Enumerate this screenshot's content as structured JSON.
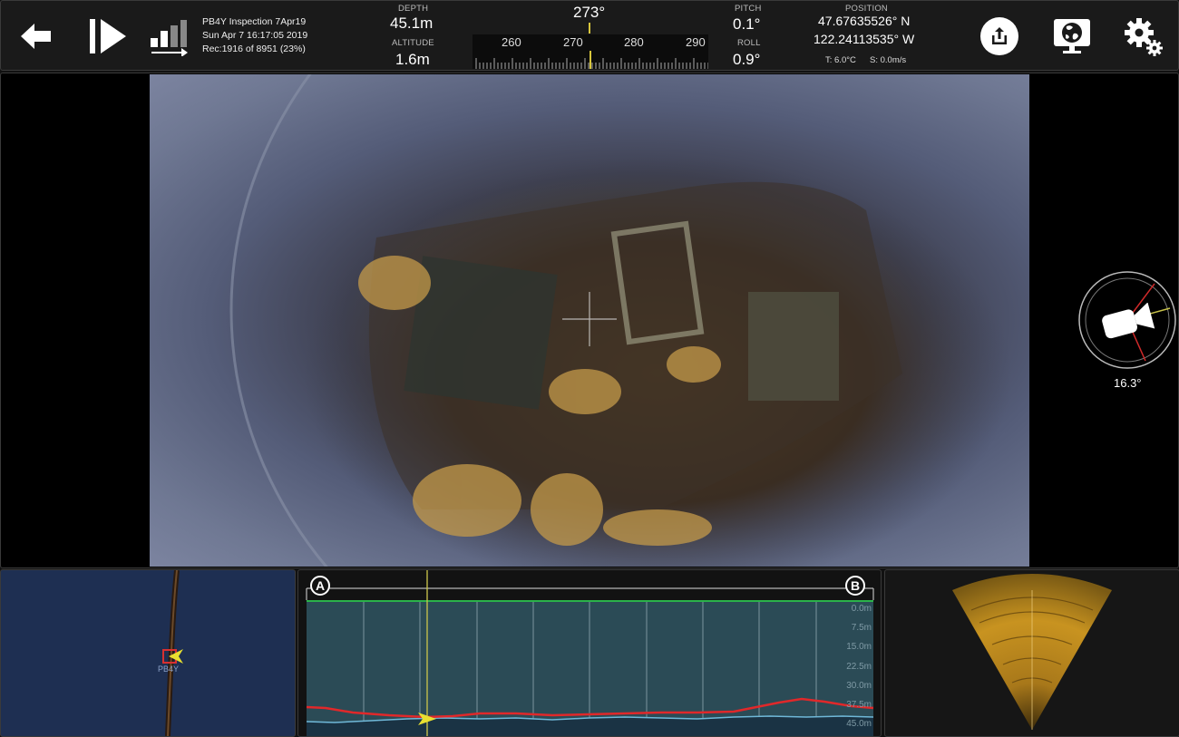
{
  "toolbar": {
    "icons": [
      "back-arrow-icon",
      "play-step-icon",
      "signal-bars-icon",
      "share-icon",
      "screen-globe-icon",
      "settings-gear-icon"
    ],
    "recording": {
      "title": "PB4Y Inspection 7Apr19",
      "datetime": "Sun Apr 7 16:17:05 2019",
      "progress": "Rec:1916 of 8951 (23%)",
      "progress_fraction": 0.23
    }
  },
  "telemetry": {
    "depth_label": "DEPTH",
    "depth_value": "45.1m",
    "altitude_label": "ALTITUDE",
    "altitude_value": "1.6m",
    "heading_value": "273°",
    "heading_ticks": [
      "260",
      "270",
      "280",
      "290"
    ],
    "pitch_label": "PITCH",
    "pitch_value": "0.1°",
    "roll_label": "ROLL",
    "roll_value": "0.9°",
    "position_label": "POSITION",
    "latitude": "47.67635526° N",
    "longitude": "122.24113535° W",
    "temperature": "T: 6.0°C",
    "speed": "S: 0.0m/s"
  },
  "camera_tilt": {
    "value": "16.3°"
  },
  "map": {
    "marker_label": "PB4Y"
  },
  "profile": {
    "start_marker": "A",
    "end_marker": "B",
    "depth_labels": [
      "0.0m",
      "7.5m",
      "15.0m",
      "22.5m",
      "30.0m",
      "37.5m",
      "45.0m"
    ]
  },
  "colors": {
    "toolbar_bg": "#1a1a1a",
    "profile_fill": "#2b4b56",
    "profile_topline": "#2bb34a",
    "depth_track": "#e0282a",
    "bottom_track": "#6fb8d8",
    "cursor": "#c8c24a",
    "map_bg": "#1e2f52",
    "sonar": "#c89320"
  }
}
